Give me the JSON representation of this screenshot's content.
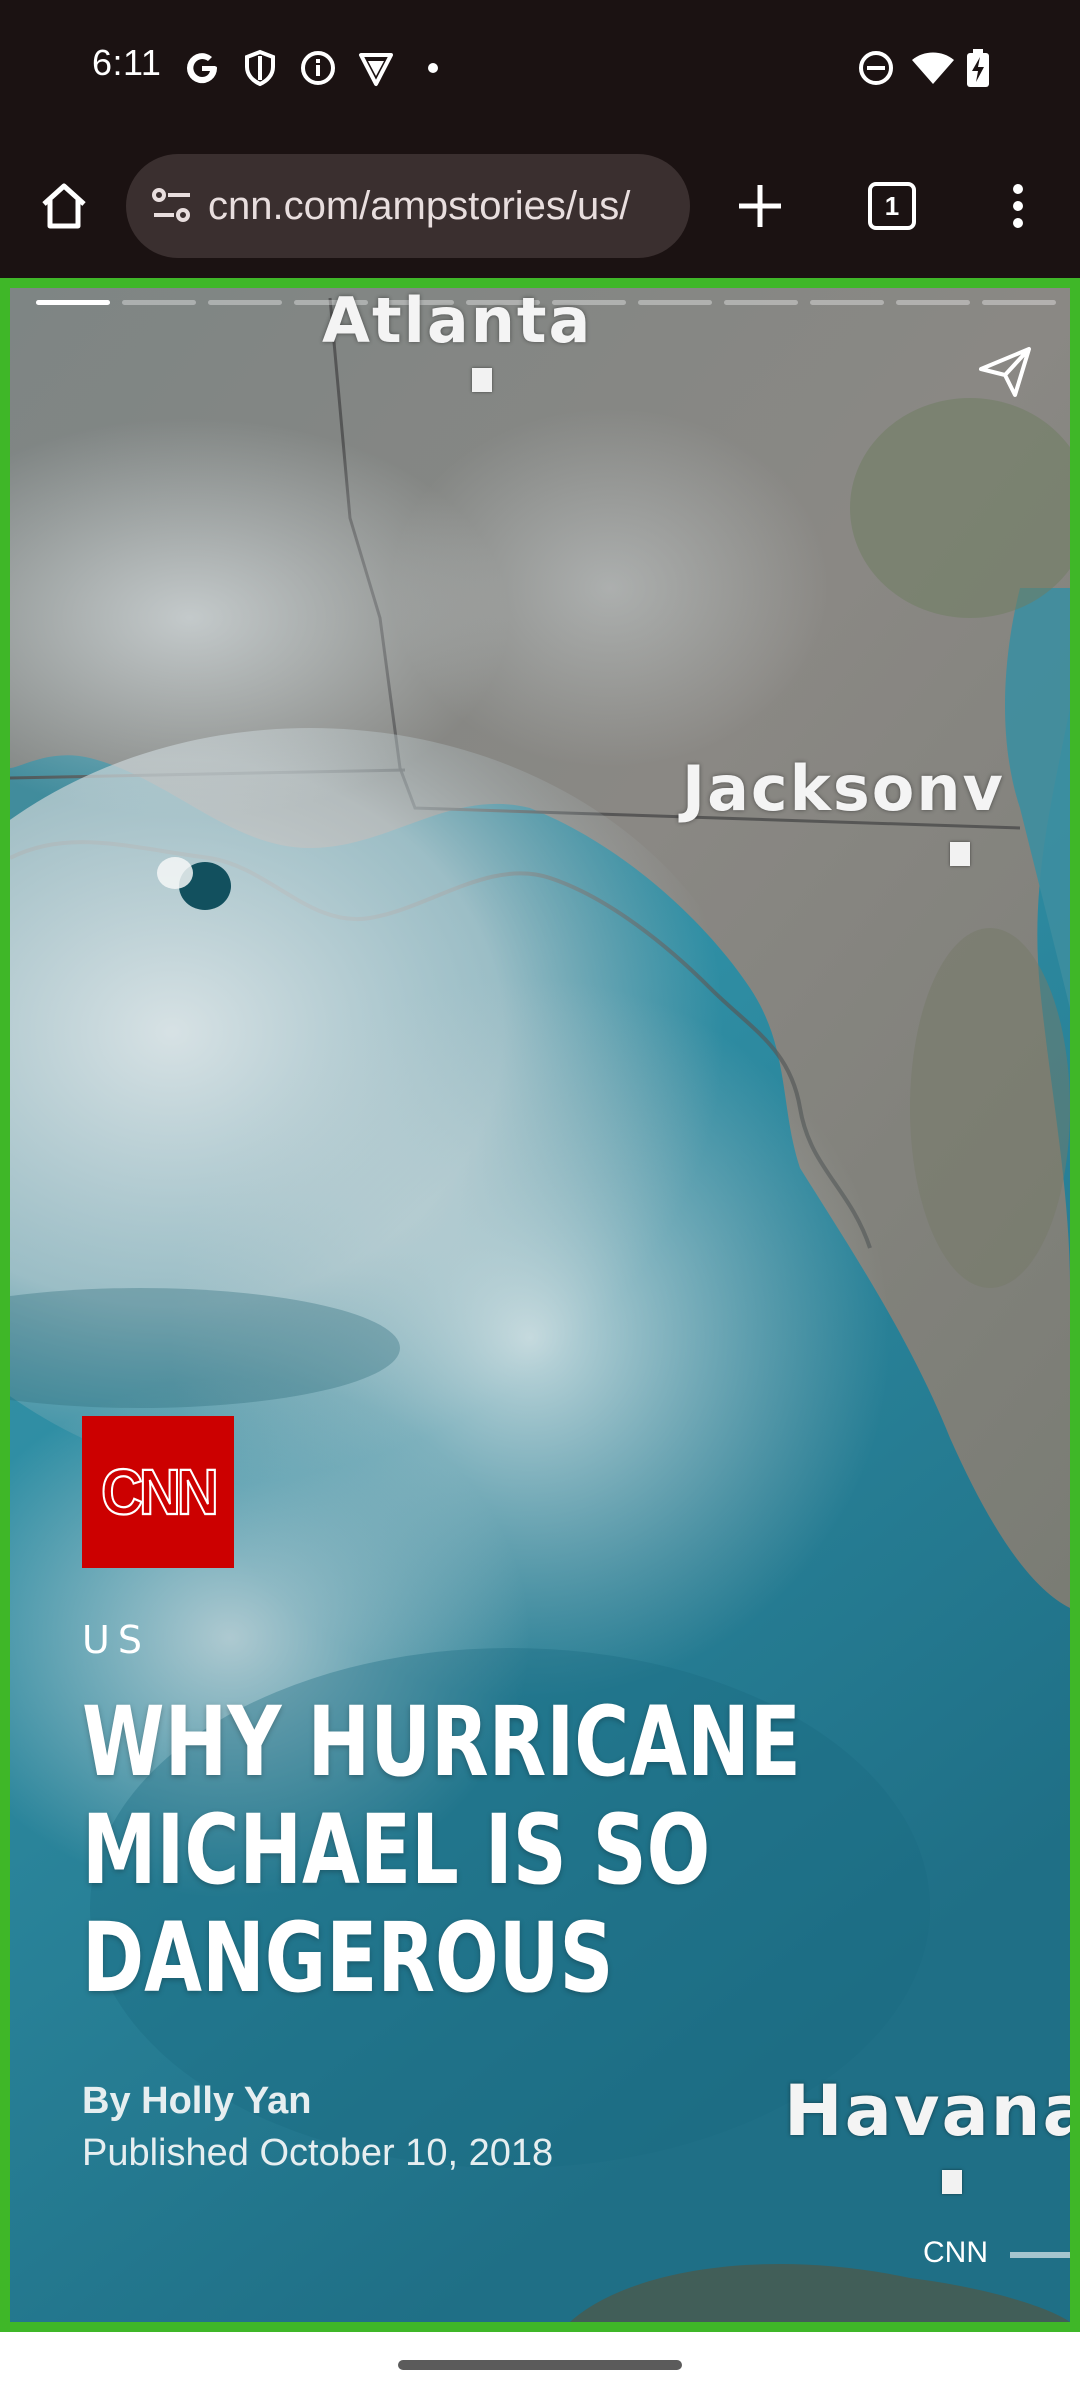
{
  "status_bar": {
    "time": "6:11",
    "left_icons": [
      "google-g-icon",
      "shield-icon",
      "info-icon",
      "vpn-shield-icon",
      "notification-dot-icon"
    ],
    "right_icons": [
      "do-not-disturb-icon",
      "wifi-icon",
      "battery-charging-icon"
    ]
  },
  "toolbar": {
    "url": "cnn.com/ampstories/us/",
    "tab_count": "1",
    "icons": [
      "home-icon",
      "site-settings-icon",
      "new-tab-plus-icon",
      "tab-switcher-icon",
      "overflow-menu-icon"
    ]
  },
  "story": {
    "progress": {
      "segment_count": 12,
      "active_index": 0,
      "active_fraction": 1.0
    },
    "map_labels": {
      "atlanta": "Atlanta",
      "jacksonville": "Jacksonv",
      "havana": "Havana"
    },
    "logo_text": "CNN",
    "section": "US",
    "headline_lines": [
      "WHY HURRICANE",
      "MICHAEL IS SO",
      "DANGEROUS"
    ],
    "byline": "By Holly Yan",
    "published": "Published October 10, 2018",
    "attribution": "CNN"
  },
  "colors": {
    "status_bg": "#1b1212",
    "omnibox_bg": "#3a2f2f",
    "story_border": "#3fb728",
    "cnn_red": "#cc0000"
  }
}
